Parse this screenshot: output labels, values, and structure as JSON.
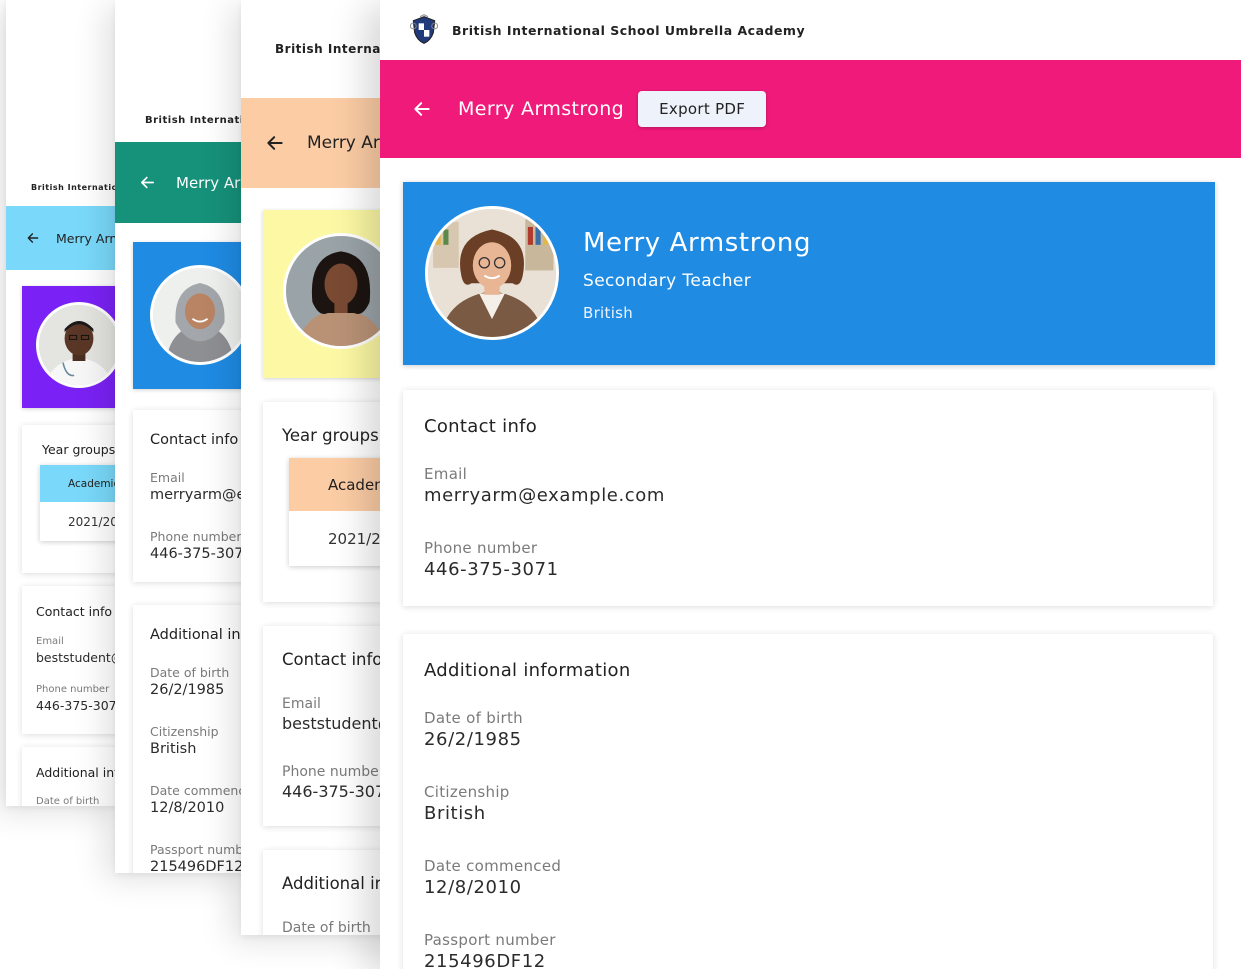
{
  "school": {
    "name": "British International School Umbrella Academy",
    "logo_icon": "school-crest-icon"
  },
  "colors": {
    "front_appbar": "#F01A7A",
    "front_hero": "#1F8BE3",
    "card4_appbar": "#FCCDA5",
    "card4_hero": "#FCF8A4",
    "card3_appbar": "#16917A",
    "card3_hero": "#1F8BE3",
    "card2_appbar": "#7AD9FA",
    "card2_hero": "#7A22F5"
  },
  "profile": {
    "name": "Merry Armstrong",
    "role": "Secondary Teacher",
    "nationality": "British",
    "export_label": "Export PDF",
    "back_icon": "arrow-left-icon"
  },
  "contact": {
    "title": "Contact info",
    "email_label": "Email",
    "email": "merryarm@example.com",
    "phone_label": "Phone number",
    "phone": "446-375-3071"
  },
  "additional": {
    "title": "Additional information",
    "dob_label": "Date of birth",
    "dob": "26/2/1985",
    "citizenship_label": "Citizenship",
    "citizenship": "British",
    "commenced_label": "Date commenced",
    "commenced": "12/8/2010",
    "passport_label": "Passport number",
    "passport": "215496DF12"
  },
  "student": {
    "email": "beststudent@",
    "phone": "446-375-307"
  },
  "year_groups": {
    "title": "Year groups",
    "header": "Academic",
    "value": "2021/2022"
  }
}
